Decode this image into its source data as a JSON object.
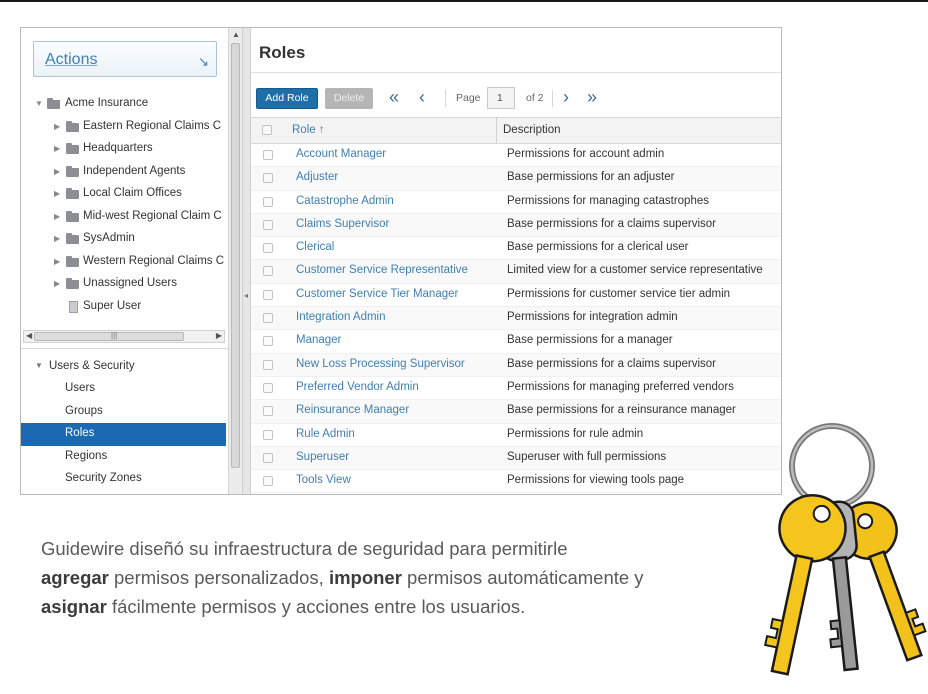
{
  "actions": {
    "label": "Actions",
    "arrow": "↘"
  },
  "tree": {
    "root": "Acme Insurance",
    "children": [
      {
        "label": "Eastern Regional Claims C",
        "type": "folder"
      },
      {
        "label": "Headquarters",
        "type": "folder"
      },
      {
        "label": "Independent Agents",
        "type": "folder"
      },
      {
        "label": "Local Claim Offices",
        "type": "folder"
      },
      {
        "label": "Mid-west Regional Claim C",
        "type": "folder"
      },
      {
        "label": "SysAdmin",
        "type": "folder"
      },
      {
        "label": "Western Regional Claims C",
        "type": "folder"
      },
      {
        "label": "Unassigned Users",
        "type": "folder"
      },
      {
        "label": "Super User",
        "type": "user"
      }
    ]
  },
  "nav": {
    "section": "Users & Security",
    "items": [
      "Users",
      "Groups",
      "Roles",
      "Regions",
      "Security Zones"
    ],
    "selected": "Roles"
  },
  "main": {
    "title": "Roles",
    "toolbar": {
      "add_label": "Add Role",
      "delete_label": "Delete",
      "page_label": "Page",
      "page_value": "1",
      "page_of": "of 2"
    },
    "columns": {
      "role": "Role ↑",
      "description": "Description"
    },
    "rows": [
      {
        "role": "Account Manager",
        "description": "Permissions for account admin"
      },
      {
        "role": "Adjuster",
        "description": "Base permissions for an adjuster"
      },
      {
        "role": "Catastrophe Admin",
        "description": "Permissions for managing catastrophes"
      },
      {
        "role": "Claims Supervisor",
        "description": "Base permissions for a claims supervisor"
      },
      {
        "role": "Clerical",
        "description": "Base permissions for a clerical user"
      },
      {
        "role": "Customer Service Representative",
        "description": "Limited view for a customer service representative"
      },
      {
        "role": "Customer Service Tier Manager",
        "description": "Permissions for customer service tier admin"
      },
      {
        "role": "Integration Admin",
        "description": "Permissions for integration admin"
      },
      {
        "role": "Manager",
        "description": "Base permissions for a manager"
      },
      {
        "role": "New Loss Processing Supervisor",
        "description": "Base permissions for a claims supervisor"
      },
      {
        "role": "Preferred Vendor Admin",
        "description": "Permissions for managing preferred vendors"
      },
      {
        "role": "Reinsurance Manager",
        "description": "Base permissions for a reinsurance manager"
      },
      {
        "role": "Rule Admin",
        "description": "Permissions for rule admin"
      },
      {
        "role": "Superuser",
        "description": "Superuser with full permissions"
      },
      {
        "role": "Tools View",
        "description": "Permissions for viewing tools page"
      }
    ]
  },
  "caption": {
    "p1": "Guidewire diseñó su infraestructura de seguridad para permitirle",
    "b1": "agregar",
    "p2": " permisos personalizados, ",
    "b2": "imponer",
    "p3": " permisos automáticamente y ",
    "b3": "asignar",
    "p4": " fácilmente permisos y acciones entre los usuarios."
  },
  "colors": {
    "accent": "#1b69b1",
    "link": "#3f7fb3",
    "key_gold": "#f2c21b",
    "key_silver": "#9a9a9a"
  },
  "icons": [
    "folder-icon",
    "user-icon",
    "first-page-icon",
    "prev-page-icon",
    "next-page-icon",
    "last-page-icon",
    "sort-asc-icon",
    "keys-illustration"
  ]
}
